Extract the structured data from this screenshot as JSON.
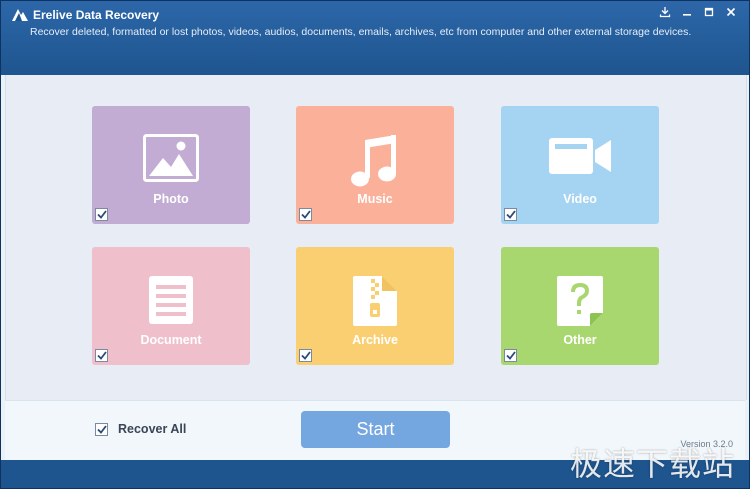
{
  "window": {
    "title": "Erelive Data Recovery",
    "subtitle": "Recover deleted, formatted or lost photos, videos, audios, documents, emails, archives, etc from computer and other external storage devices.",
    "controls": [
      "download-icon",
      "minimize-icon",
      "restore-icon",
      "close-icon"
    ]
  },
  "tiles": [
    {
      "label": "Photo",
      "color": "#c3acd3",
      "icon": "photo-icon",
      "checked": true
    },
    {
      "label": "Music",
      "color": "#fbb09a",
      "icon": "music-icon",
      "checked": true
    },
    {
      "label": "Video",
      "color": "#a5d3f2",
      "icon": "video-icon",
      "checked": true
    },
    {
      "label": "Document",
      "color": "#efbfcc",
      "icon": "document-icon",
      "checked": true
    },
    {
      "label": "Archive",
      "color": "#f9cf72",
      "icon": "archive-icon",
      "checked": true
    },
    {
      "label": "Other",
      "color": "#a9d76f",
      "icon": "question-icon",
      "checked": true
    }
  ],
  "bottom": {
    "recover_all_label": "Recover All",
    "recover_all_checked": true,
    "start_label": "Start",
    "version": "Version 3.2.0"
  },
  "watermark": "极速下载站",
  "colors": {
    "titlebar": "#1e558f",
    "accent_button": "#74a6e0"
  }
}
